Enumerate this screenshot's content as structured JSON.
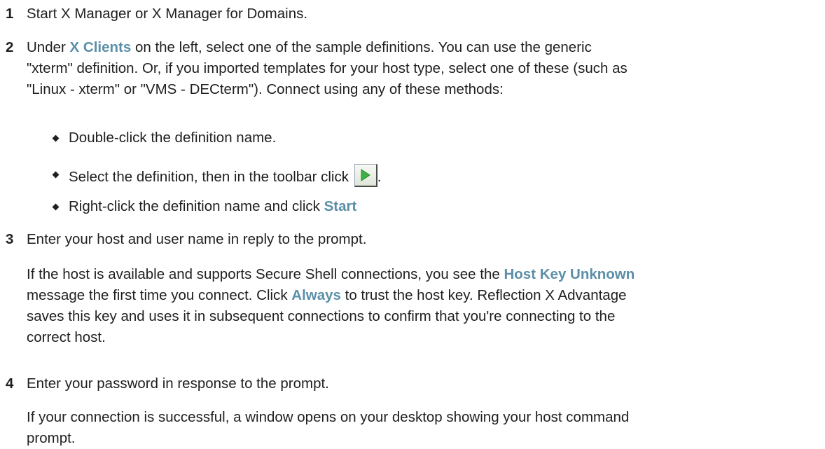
{
  "steps": [
    {
      "num": "1",
      "text": "Start X Manager or X Manager for Domains."
    },
    {
      "num": "2",
      "pre": "Under ",
      "ui": "X Clients",
      "line1_post": " on the left, select one of the sample definitions. You can use the generic",
      "line2": "\"xterm\" definition. Or, if you imported templates for your host type, select one of these (such as",
      "line3": "\"Linux - xterm\" or \"VMS - DECterm\"). Connect using any of these methods:",
      "bullets": [
        {
          "text": "Double-click the definition name."
        },
        {
          "text": "Select the definition, then in the toolbar click ",
          "icon": "play-icon",
          "after": "."
        },
        {
          "text": "Right-click the definition name and click ",
          "ui": "Start"
        }
      ]
    },
    {
      "num": "3",
      "text": "Enter your host and user name in reply to the prompt.",
      "para": {
        "l1_pre": "If the host is available and supports Secure Shell connections, you see the ",
        "l1_ui": "Host Key Unknown",
        "l2_pre": "message the first time you connect. Click ",
        "l2_ui": "Always",
        "l2_post": " to trust the host key. Reflection X Advantage",
        "l3": "saves this key and uses it in subsequent connections to confirm that you're connecting to the",
        "l4": "correct host."
      }
    },
    {
      "num": "4",
      "text": "Enter your password in response to the prompt.",
      "para": {
        "l1": "If your connection is successful, a window opens on your desktop showing your host command",
        "l2": "prompt."
      }
    }
  ],
  "colors": {
    "ui_label": "#5b8fa8",
    "text": "#1f1f1f",
    "play_green": "#3cb043"
  }
}
